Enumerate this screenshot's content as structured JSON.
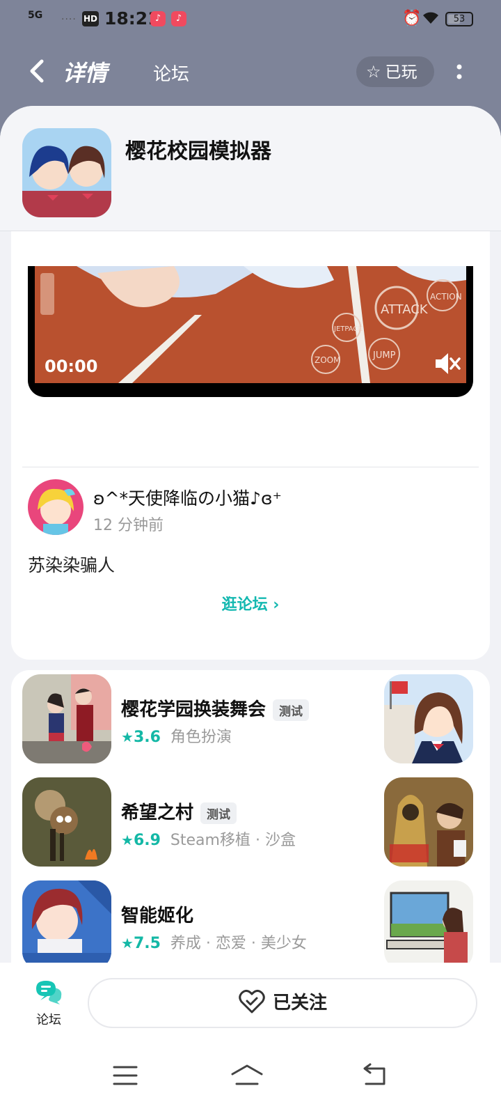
{
  "status_bar": {
    "signal": "5G",
    "signal2": "....",
    "hd": "HD",
    "time": "18:21",
    "battery": "53",
    "battery_level": 0.53
  },
  "nav": {
    "tab_detail": "详情",
    "tab_forum": "论坛",
    "played_label": "已玩"
  },
  "app": {
    "title": "樱花校园模拟器"
  },
  "video": {
    "time": "00:00"
  },
  "post": {
    "user": "ʚ^*天使降临の小猫♪ɞ⁺",
    "time": "12 分钟前",
    "content": "苏染染骗人",
    "forum_link": "逛论坛 ›"
  },
  "recommendations": [
    {
      "name": "樱花学园换装舞会",
      "badge": "测试",
      "rating": "3.6",
      "tags": "角色扮演"
    },
    {
      "name": "希望之村",
      "badge": "测试",
      "rating": "6.9",
      "tags": "Steam移植 · 沙盒"
    },
    {
      "name": "智能姬化",
      "badge": "",
      "rating": "7.5",
      "tags": "养成 · 恋爱 · 美少女"
    }
  ],
  "bottom": {
    "forum_label": "论坛",
    "follow_label": "已关注"
  },
  "colors": {
    "accent": "#14b8a6",
    "header_bg": "#7e8499"
  }
}
